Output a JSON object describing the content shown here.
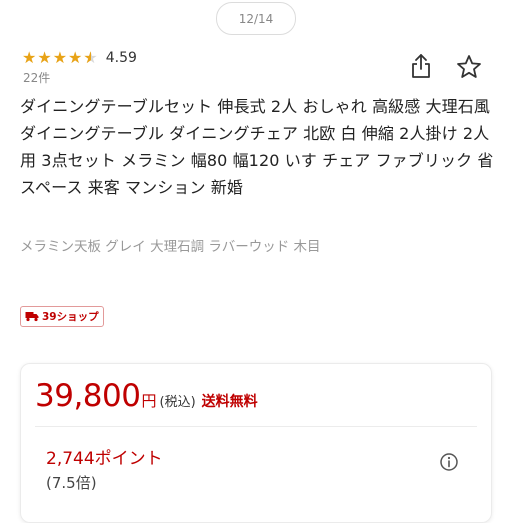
{
  "pager": {
    "text": "12/14"
  },
  "rating": {
    "value": "4.59",
    "score": 4.59,
    "review_count": "22件"
  },
  "icons": {
    "share": "share-icon",
    "favorite": "star-outline-icon",
    "info": "info-icon",
    "shipping_truck": "truck-icon"
  },
  "product": {
    "title": "ダイニングテーブルセット 伸長式 2人 おしゃれ 高級感 大理石風 ダイニングテーブル ダイニングチェア 北欧 白 伸縮 2人掛け 2人用 3点セット メラミン 幅80 幅120 いす チェア ファブリック 省スペース 来客 マンション 新婚",
    "variant": "メラミン天板 グレイ 大理石調 ラバーウッド 木目"
  },
  "badge": {
    "label": "39ショップ"
  },
  "price": {
    "amount": "39,800",
    "currency": "円",
    "tax_note": "(税込)",
    "shipping": "送料無料",
    "points": "2,744ポイント",
    "multiplier": "(7.5倍)"
  },
  "colors": {
    "accent": "#bf0000",
    "star": "#e8a317",
    "muted": "#999999"
  }
}
